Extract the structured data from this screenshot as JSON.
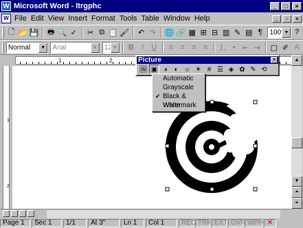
{
  "window": {
    "title": "Microsoft Word - ltrgphc",
    "app_icon": "W",
    "doc_icon": "W"
  },
  "menubar": {
    "items": [
      "File",
      "Edit",
      "View",
      "Insert",
      "Format",
      "Tools",
      "Table",
      "Window",
      "Help"
    ]
  },
  "standard_toolbar": {
    "zoom": "100%"
  },
  "formatting_toolbar": {
    "style": "Normal",
    "font": "Arial",
    "size": "12"
  },
  "ruler": {
    "numbers": [
      "1",
      "2",
      "3",
      "4",
      "5"
    ]
  },
  "vertical_ruler": {
    "numbers": [
      "1",
      "2"
    ]
  },
  "picture_toolbar": {
    "title": "Picture",
    "close": "×"
  },
  "image_control_menu": {
    "items": [
      {
        "label": "Automatic",
        "checked": false
      },
      {
        "label": "Grayscale",
        "checked": false
      },
      {
        "label": "Black & White",
        "checked": true
      },
      {
        "label": "Watermark",
        "checked": false
      }
    ]
  },
  "statusbar": {
    "page": "Page  1",
    "section": "Sec  1",
    "page_of": "1/1",
    "at": "At  3\"",
    "line": "Ln  1",
    "col": "Col  1",
    "modes": [
      "REC",
      "TRK",
      "EXT",
      "OVR",
      "WPH"
    ]
  },
  "colors": {
    "titlebar": "#000080",
    "face": "#c0c0c0"
  }
}
